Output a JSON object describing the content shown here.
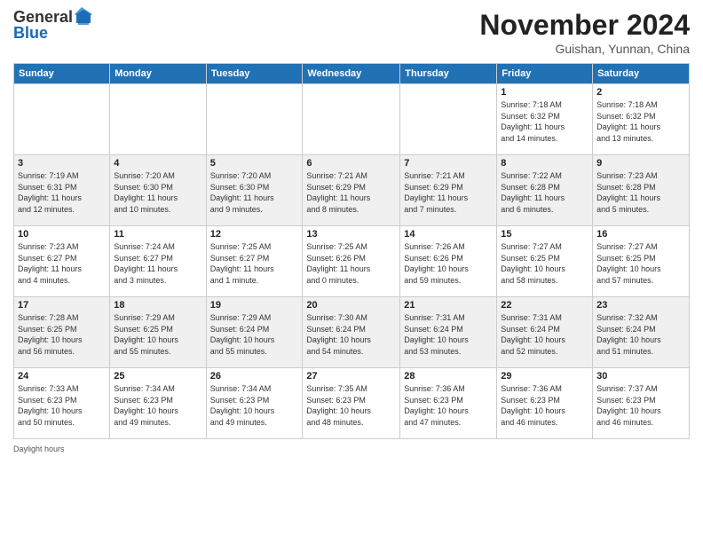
{
  "header": {
    "logo_general": "General",
    "logo_blue": "Blue",
    "month_title": "November 2024",
    "subtitle": "Guishan, Yunnan, China"
  },
  "days_of_week": [
    "Sunday",
    "Monday",
    "Tuesday",
    "Wednesday",
    "Thursday",
    "Friday",
    "Saturday"
  ],
  "footer_label": "Daylight hours",
  "weeks": [
    [
      {
        "day": "",
        "info": ""
      },
      {
        "day": "",
        "info": ""
      },
      {
        "day": "",
        "info": ""
      },
      {
        "day": "",
        "info": ""
      },
      {
        "day": "",
        "info": ""
      },
      {
        "day": "1",
        "info": "Sunrise: 7:18 AM\nSunset: 6:32 PM\nDaylight: 11 hours\nand 14 minutes."
      },
      {
        "day": "2",
        "info": "Sunrise: 7:18 AM\nSunset: 6:32 PM\nDaylight: 11 hours\nand 13 minutes."
      }
    ],
    [
      {
        "day": "3",
        "info": "Sunrise: 7:19 AM\nSunset: 6:31 PM\nDaylight: 11 hours\nand 12 minutes."
      },
      {
        "day": "4",
        "info": "Sunrise: 7:20 AM\nSunset: 6:30 PM\nDaylight: 11 hours\nand 10 minutes."
      },
      {
        "day": "5",
        "info": "Sunrise: 7:20 AM\nSunset: 6:30 PM\nDaylight: 11 hours\nand 9 minutes."
      },
      {
        "day": "6",
        "info": "Sunrise: 7:21 AM\nSunset: 6:29 PM\nDaylight: 11 hours\nand 8 minutes."
      },
      {
        "day": "7",
        "info": "Sunrise: 7:21 AM\nSunset: 6:29 PM\nDaylight: 11 hours\nand 7 minutes."
      },
      {
        "day": "8",
        "info": "Sunrise: 7:22 AM\nSunset: 6:28 PM\nDaylight: 11 hours\nand 6 minutes."
      },
      {
        "day": "9",
        "info": "Sunrise: 7:23 AM\nSunset: 6:28 PM\nDaylight: 11 hours\nand 5 minutes."
      }
    ],
    [
      {
        "day": "10",
        "info": "Sunrise: 7:23 AM\nSunset: 6:27 PM\nDaylight: 11 hours\nand 4 minutes."
      },
      {
        "day": "11",
        "info": "Sunrise: 7:24 AM\nSunset: 6:27 PM\nDaylight: 11 hours\nand 3 minutes."
      },
      {
        "day": "12",
        "info": "Sunrise: 7:25 AM\nSunset: 6:27 PM\nDaylight: 11 hours\nand 1 minute."
      },
      {
        "day": "13",
        "info": "Sunrise: 7:25 AM\nSunset: 6:26 PM\nDaylight: 11 hours\nand 0 minutes."
      },
      {
        "day": "14",
        "info": "Sunrise: 7:26 AM\nSunset: 6:26 PM\nDaylight: 10 hours\nand 59 minutes."
      },
      {
        "day": "15",
        "info": "Sunrise: 7:27 AM\nSunset: 6:25 PM\nDaylight: 10 hours\nand 58 minutes."
      },
      {
        "day": "16",
        "info": "Sunrise: 7:27 AM\nSunset: 6:25 PM\nDaylight: 10 hours\nand 57 minutes."
      }
    ],
    [
      {
        "day": "17",
        "info": "Sunrise: 7:28 AM\nSunset: 6:25 PM\nDaylight: 10 hours\nand 56 minutes."
      },
      {
        "day": "18",
        "info": "Sunrise: 7:29 AM\nSunset: 6:25 PM\nDaylight: 10 hours\nand 55 minutes."
      },
      {
        "day": "19",
        "info": "Sunrise: 7:29 AM\nSunset: 6:24 PM\nDaylight: 10 hours\nand 55 minutes."
      },
      {
        "day": "20",
        "info": "Sunrise: 7:30 AM\nSunset: 6:24 PM\nDaylight: 10 hours\nand 54 minutes."
      },
      {
        "day": "21",
        "info": "Sunrise: 7:31 AM\nSunset: 6:24 PM\nDaylight: 10 hours\nand 53 minutes."
      },
      {
        "day": "22",
        "info": "Sunrise: 7:31 AM\nSunset: 6:24 PM\nDaylight: 10 hours\nand 52 minutes."
      },
      {
        "day": "23",
        "info": "Sunrise: 7:32 AM\nSunset: 6:24 PM\nDaylight: 10 hours\nand 51 minutes."
      }
    ],
    [
      {
        "day": "24",
        "info": "Sunrise: 7:33 AM\nSunset: 6:23 PM\nDaylight: 10 hours\nand 50 minutes."
      },
      {
        "day": "25",
        "info": "Sunrise: 7:34 AM\nSunset: 6:23 PM\nDaylight: 10 hours\nand 49 minutes."
      },
      {
        "day": "26",
        "info": "Sunrise: 7:34 AM\nSunset: 6:23 PM\nDaylight: 10 hours\nand 49 minutes."
      },
      {
        "day": "27",
        "info": "Sunrise: 7:35 AM\nSunset: 6:23 PM\nDaylight: 10 hours\nand 48 minutes."
      },
      {
        "day": "28",
        "info": "Sunrise: 7:36 AM\nSunset: 6:23 PM\nDaylight: 10 hours\nand 47 minutes."
      },
      {
        "day": "29",
        "info": "Sunrise: 7:36 AM\nSunset: 6:23 PM\nDaylight: 10 hours\nand 46 minutes."
      },
      {
        "day": "30",
        "info": "Sunrise: 7:37 AM\nSunset: 6:23 PM\nDaylight: 10 hours\nand 46 minutes."
      }
    ]
  ]
}
